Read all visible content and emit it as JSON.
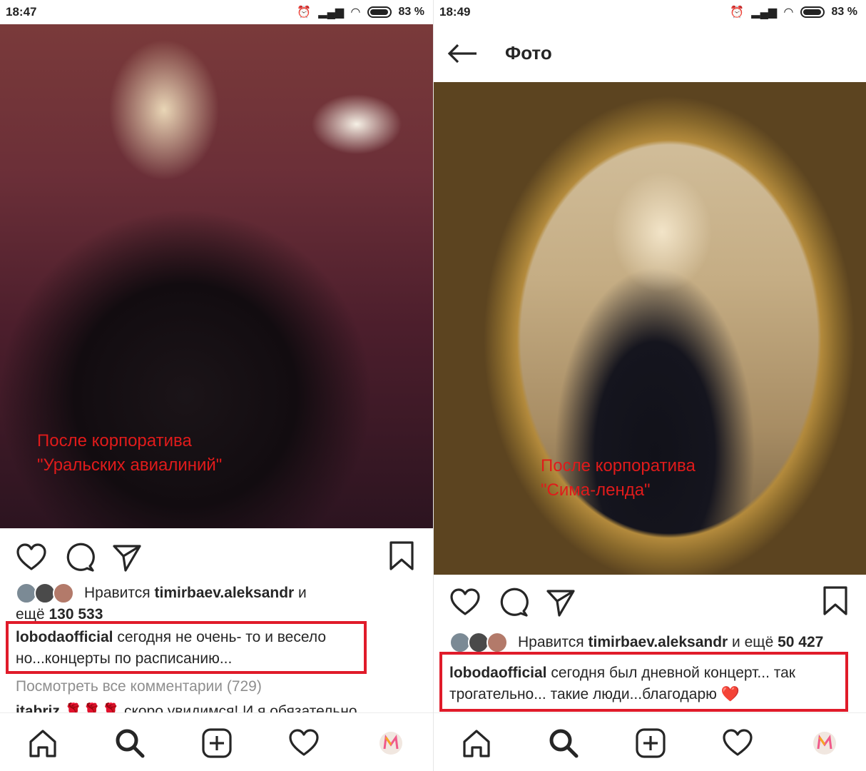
{
  "left": {
    "status": {
      "time": "18:47",
      "battery": "83 %"
    },
    "overlay": {
      "line1": "После корпоратива",
      "line2": "\"Уральских авиалиний\""
    },
    "likes": {
      "prefix": "Нравится ",
      "user": "timirbaev.aleksandr",
      "mid": " и",
      "line2prefix": "ещё ",
      "count": "130 533"
    },
    "caption": {
      "user": "lobodaofficial",
      "text": " сегодня не очень- то и весело но...концерты по расписанию..."
    },
    "view_comments": "Посмотреть все комментарии (729)",
    "comment": {
      "user": "itabriz",
      "text": " 🌹🌹🌹 скоро увидимся! И я обязательно"
    }
  },
  "right": {
    "status": {
      "time": "18:49",
      "battery": "83 %"
    },
    "appbar": {
      "title": "Фото",
      "back": "←"
    },
    "overlay": {
      "line1": "После корпоратива",
      "line2": "\"Сима-ленда\""
    },
    "likes": {
      "prefix": "Нравится ",
      "user": "timirbaev.aleksandr",
      "mid": " и ещё ",
      "count": "50 427"
    },
    "caption": {
      "user": "lobodaofficial",
      "text": " сегодня был дневной концерт... так трогательно... такие люди...благодарю ❤️"
    }
  },
  "colors": {
    "highlight_red": "#e01b2a",
    "overlay_text_red": "#e01b1b"
  },
  "icons": [
    "heart-icon",
    "comment-icon",
    "share-icon",
    "bookmark-icon",
    "home-icon",
    "search-icon",
    "add-post-icon",
    "activity-heart-icon",
    "profile-avatar-icon"
  ]
}
